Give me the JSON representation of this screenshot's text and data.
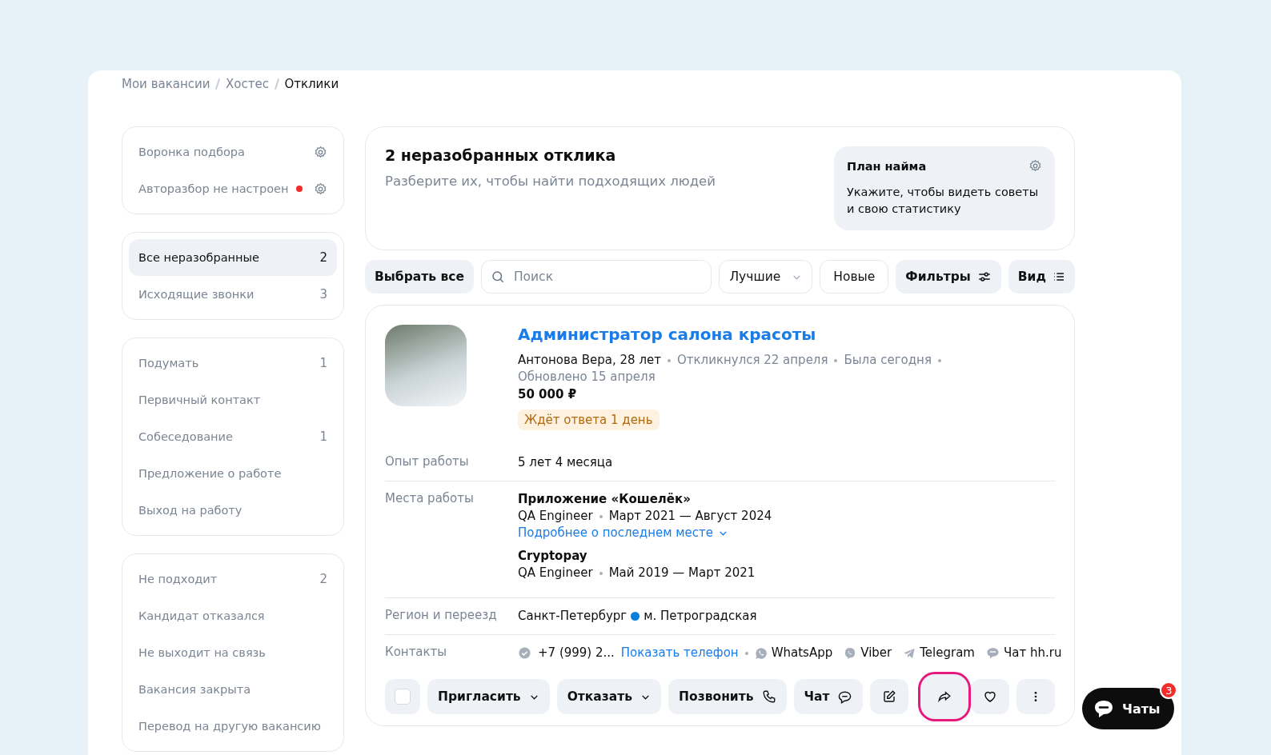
{
  "breadcrumbs": [
    {
      "label": "Мои вакансии",
      "current": false
    },
    {
      "label": "Хостес",
      "current": false
    },
    {
      "label": "Отклики",
      "current": true
    }
  ],
  "sidebar": {
    "groups": [
      {
        "items": [
          {
            "kind": "setting",
            "label": "Воронка подбора",
            "alert": false
          },
          {
            "kind": "setting",
            "label": "Авторазбор не настроен",
            "alert": true
          }
        ]
      },
      {
        "items": [
          {
            "kind": "filter",
            "label": "Все неразобранные",
            "count": "2",
            "selected": true
          },
          {
            "kind": "filter",
            "label": "Исходящие звонки",
            "count": "3",
            "selected": false
          }
        ]
      },
      {
        "items": [
          {
            "kind": "filter",
            "label": "Подумать",
            "count": "1",
            "selected": false
          },
          {
            "kind": "filter",
            "label": "Первичный контакт",
            "selected": false
          },
          {
            "kind": "filter",
            "label": "Собеседование",
            "count": "1",
            "selected": false
          },
          {
            "kind": "filter",
            "label": "Предложение о работе",
            "selected": false
          },
          {
            "kind": "filter",
            "label": "Выход на работу",
            "selected": false
          }
        ]
      },
      {
        "items": [
          {
            "kind": "filter",
            "label": "Не подходит",
            "count": "2",
            "selected": false
          },
          {
            "kind": "filter",
            "label": "Кандидат отказался",
            "selected": false
          },
          {
            "kind": "filter",
            "label": "Не выходит на связь",
            "selected": false
          },
          {
            "kind": "filter",
            "label": "Вакансия закрыта",
            "selected": false
          },
          {
            "kind": "filter",
            "label": "Перевод на другую вакансию",
            "selected": false
          }
        ]
      }
    ]
  },
  "summary": {
    "title": "2 неразобранных отклика",
    "subtitle": "Разберите их, чтобы найти подходящих людей",
    "plan": {
      "title": "План найма",
      "text": "Укажите, чтобы видеть советы и свою статистику"
    }
  },
  "toolbar": {
    "select_all": "Выбрать все",
    "search": {
      "placeholder": "Поиск"
    },
    "sort": "Лучшие",
    "new": "Новые",
    "filters": "Фильтры",
    "view": "Вид"
  },
  "card": {
    "vacancy": "Администратор салона красоты",
    "candidate": "Антонова Вера, 28 лет",
    "meta": [
      "Откликнулся 22 апреля",
      "Была сегодня",
      "Обновлено 15 апреля"
    ],
    "salary": "50 000 ₽",
    "status": "Ждёт ответа 1 день",
    "experience": {
      "label": "Опыт работы",
      "value": "5 лет 4 месяца"
    },
    "workplaces": {
      "label": "Места работы",
      "items": [
        {
          "company": "Приложение «Кошелёк»",
          "position": "QA Engineer",
          "period": "Март 2021 — Август 2024",
          "more": "Подробнее о последнем месте"
        },
        {
          "company": "Cryptopay",
          "position": "QA Engineer",
          "period": "Май 2019 — Март 2021"
        }
      ]
    },
    "region": {
      "label": "Регион и переезд",
      "city": "Санкт-Петербург",
      "metro": "м. Петроградская",
      "color": "#0b7fd9"
    },
    "contacts": {
      "label": "Контакты",
      "phone": "+7 (999) 2...",
      "show_phone": "Показать телефон",
      "messengers": [
        {
          "kind": "whatsapp",
          "label": "WhatsApp"
        },
        {
          "kind": "viber",
          "label": "Viber"
        },
        {
          "kind": "telegram",
          "label": "Telegram"
        },
        {
          "kind": "chat",
          "label": "Чат hh.ru"
        }
      ]
    },
    "actions": {
      "checked": false,
      "buttons": [
        {
          "kind": "dropdown",
          "label": "Пригласить"
        },
        {
          "kind": "dropdown",
          "label": "Отказать"
        },
        {
          "kind": "call",
          "label": "Позвонить"
        },
        {
          "kind": "chat",
          "label": "Чат"
        },
        {
          "kind": "edit"
        }
      ],
      "side": [
        {
          "kind": "share",
          "highlighted": true
        },
        {
          "kind": "favorite",
          "highlighted": false
        },
        {
          "kind": "more",
          "highlighted": false
        }
      ]
    }
  },
  "chat_button": {
    "label": "Чаты",
    "badge": "3"
  }
}
